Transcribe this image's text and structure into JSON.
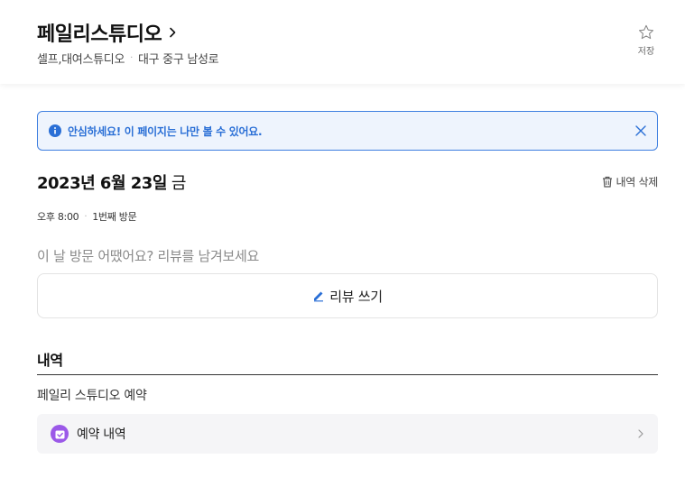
{
  "header": {
    "title": "페일리스튜디오",
    "categories": "셀프,대여스튜디오",
    "location": "대구 중구 남성로",
    "save_label": "저장"
  },
  "notice": {
    "text": "안심하세요! 이 페이지는 나만 볼 수 있어요."
  },
  "visit": {
    "date": "2023년 6월 23일",
    "weekday": "금",
    "delete_label": "내역 삭제",
    "time": "오후 8:00",
    "visit_count": "1번째 방문"
  },
  "review": {
    "prompt": "이 날 방문 어땠어요? 리뷰를 남겨보세요",
    "button_label": "리뷰 쓰기"
  },
  "history": {
    "section_title": "내역",
    "item_name": "페일리 스튜디오 예약",
    "row_label": "예약 내역"
  },
  "colors": {
    "accent_blue": "#2a6fd6",
    "notice_bg": "#eef4fd",
    "history_icon": "#9b59e8"
  },
  "icons": {
    "title_chevron": "chevron-right-icon",
    "save": "star-outline-icon",
    "notice": "info-icon",
    "notice_close": "close-icon",
    "delete": "trash-icon",
    "review": "pencil-icon",
    "history": "calendar-check-icon",
    "history_chevron": "chevron-right-icon"
  }
}
